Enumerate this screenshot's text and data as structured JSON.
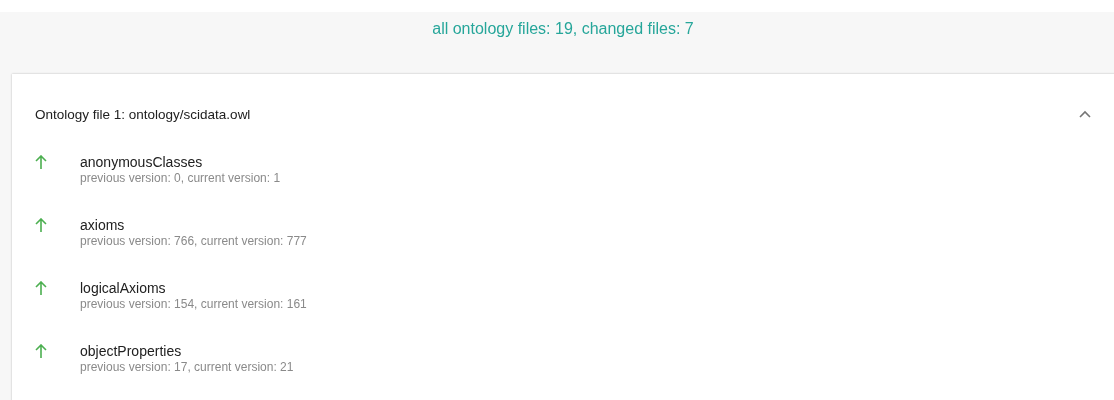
{
  "summary": "all ontology files: 19, changed files: 7",
  "panels": [
    {
      "title": "Ontology file 1: ontology/scidata.owl",
      "expanded": true,
      "items": [
        {
          "kind": "increase",
          "name": "anonymousClasses",
          "detail": "previous version: 0, current version: 1"
        },
        {
          "kind": "increase",
          "name": "axioms",
          "detail": "previous version: 766, current version: 777"
        },
        {
          "kind": "increase",
          "name": "logicalAxioms",
          "detail": "previous version: 154, current version: 161"
        },
        {
          "kind": "increase",
          "name": "objectProperties",
          "detail": "previous version: 17, current version: 21"
        }
      ]
    }
  ]
}
